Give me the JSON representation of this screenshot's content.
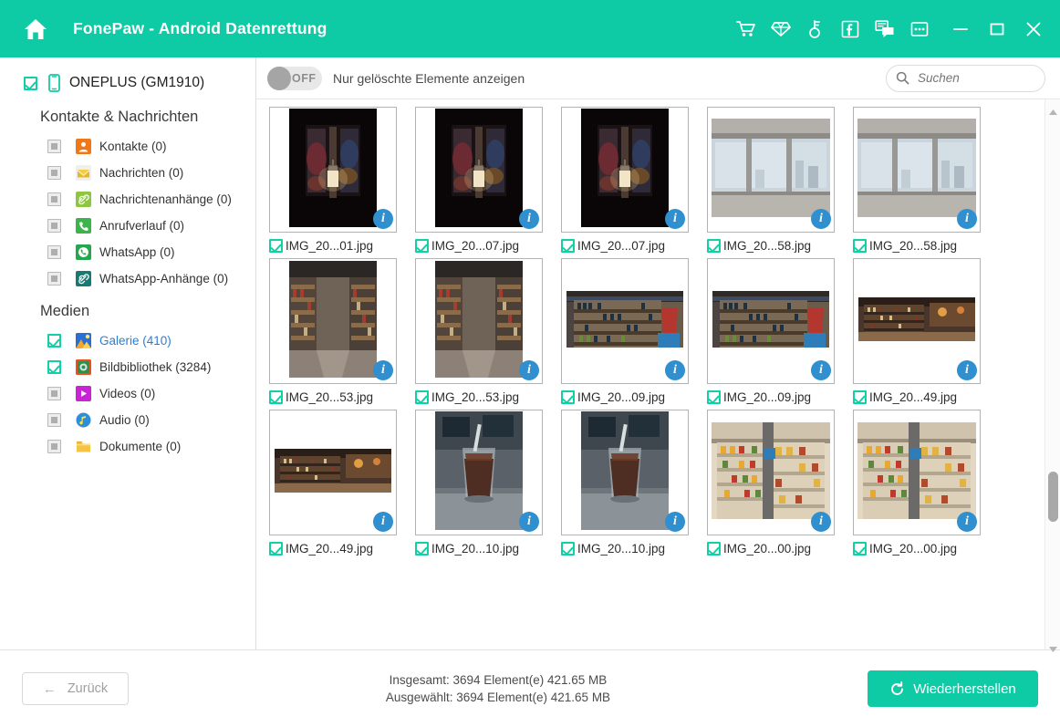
{
  "titlebar": {
    "app_title": "FonePaw - Android Datenrettung",
    "home_icon": "home-icon",
    "bg_color": "#0ECAA5",
    "icons": [
      {
        "name": "cart-icon"
      },
      {
        "name": "diamond-icon"
      },
      {
        "name": "key-icon"
      },
      {
        "name": "facebook-icon"
      },
      {
        "name": "feedback-icon"
      },
      {
        "name": "more-options-icon"
      }
    ],
    "window_controls": [
      {
        "name": "minimize-button"
      },
      {
        "name": "maximize-button"
      },
      {
        "name": "close-button"
      }
    ]
  },
  "sidebar": {
    "device": {
      "label": "ONEPLUS (GM1910)",
      "checked": true,
      "icon": "phone-icon"
    },
    "groups": [
      {
        "title": "Kontakte & Nachrichten",
        "items": [
          {
            "label": "Kontakte (0)",
            "checked": false,
            "icon": "contacts-icon",
            "color": "#F07818",
            "active": false
          },
          {
            "label": "Nachrichten (0)",
            "checked": false,
            "icon": "messages-icon",
            "color": "#F2C53D",
            "active": false
          },
          {
            "label": "Nachrichtenanhänge (0)",
            "checked": false,
            "icon": "message-attachments-icon",
            "color": "#8DC63F",
            "active": false
          },
          {
            "label": "Anrufverlauf (0)",
            "checked": false,
            "icon": "call-history-icon",
            "color": "#3BB54A",
            "active": false
          },
          {
            "label": "WhatsApp (0)",
            "checked": false,
            "icon": "whatsapp-icon",
            "color": "#25A84D",
            "active": false
          },
          {
            "label": "WhatsApp-Anhänge (0)",
            "checked": false,
            "icon": "whatsapp-attachments-icon",
            "color": "#157A73",
            "active": false
          }
        ]
      },
      {
        "title": "Medien",
        "items": [
          {
            "label": "Galerie (410)",
            "checked": true,
            "icon": "gallery-icon",
            "color": "#F5A623",
            "active": true
          },
          {
            "label": "Bildbibliothek (3284)",
            "checked": true,
            "icon": "picture-library-icon",
            "color": "#E8521E",
            "active": false
          },
          {
            "label": "Videos (0)",
            "checked": false,
            "icon": "videos-icon",
            "color": "#C724D6",
            "active": false
          },
          {
            "label": "Audio (0)",
            "checked": false,
            "icon": "audio-icon",
            "color": "#2E8FD8",
            "active": false
          },
          {
            "label": "Dokumente (0)",
            "checked": false,
            "icon": "documents-icon",
            "color": "#F6C445",
            "active": false
          }
        ]
      }
    ]
  },
  "toolbar": {
    "toggle": {
      "state_label": "OFF",
      "checked": false,
      "name": "show-deleted-only-toggle"
    },
    "toggle_label": "Nur gelöschte Elemente anzeigen",
    "search": {
      "value": "",
      "placeholder": "Suchen",
      "icon": "search-icon"
    }
  },
  "grid": {
    "items": [
      {
        "name": "IMG_20...01.jpg",
        "checked": true,
        "thumb": "lantern-dark-portrait",
        "orient": "portrait"
      },
      {
        "name": "IMG_20...07.jpg",
        "checked": true,
        "thumb": "lantern-dark-portrait",
        "orient": "portrait"
      },
      {
        "name": "IMG_20...07.jpg",
        "checked": true,
        "thumb": "lantern-dark-portrait",
        "orient": "portrait"
      },
      {
        "name": "IMG_20...58.jpg",
        "checked": true,
        "thumb": "window-city-view",
        "orient": "landscape-tall"
      },
      {
        "name": "IMG_20...58.jpg",
        "checked": true,
        "thumb": "window-city-view",
        "orient": "landscape-tall"
      },
      {
        "name": "IMG_20...53.jpg",
        "checked": true,
        "thumb": "store-aisle-portrait",
        "orient": "portrait"
      },
      {
        "name": "IMG_20...53.jpg",
        "checked": true,
        "thumb": "store-aisle-portrait",
        "orient": "portrait"
      },
      {
        "name": "IMG_20...09.jpg",
        "checked": true,
        "thumb": "wine-shelves-wide",
        "orient": "landscape"
      },
      {
        "name": "IMG_20...09.jpg",
        "checked": true,
        "thumb": "wine-shelves-wide",
        "orient": "landscape"
      },
      {
        "name": "IMG_20...49.jpg",
        "checked": true,
        "thumb": "bar-interior-wide",
        "orient": "landscape"
      },
      {
        "name": "IMG_20...49.jpg",
        "checked": true,
        "thumb": "bar-interior-wide",
        "orient": "landscape"
      },
      {
        "name": "IMG_20...10.jpg",
        "checked": true,
        "thumb": "iced-drink-portrait",
        "orient": "portrait"
      },
      {
        "name": "IMG_20...10.jpg",
        "checked": true,
        "thumb": "iced-drink-portrait",
        "orient": "portrait"
      },
      {
        "name": "IMG_20...00.jpg",
        "checked": true,
        "thumb": "market-shelves-tall",
        "orient": "landscape-tall"
      },
      {
        "name": "IMG_20...00.jpg",
        "checked": true,
        "thumb": "market-shelves-tall",
        "orient": "landscape-tall"
      }
    ],
    "info_badge_label": "i"
  },
  "footer": {
    "back_button": {
      "label": "Zurück",
      "icon": "arrow-left-icon"
    },
    "total_line": "Insgesamt: 3694 Element(e) 421.65 MB",
    "selected_line": "Ausgewählt: 3694 Element(e) 421.65 MB",
    "restore_button": {
      "label": "Wiederherstellen",
      "icon": "restore-icon",
      "color": "#0ECAA5"
    }
  },
  "scrollbar": {
    "up_arrow": "scroll-up-arrow",
    "down_arrow": "scroll-down-arrow",
    "thumb": "scroll-thumb"
  }
}
